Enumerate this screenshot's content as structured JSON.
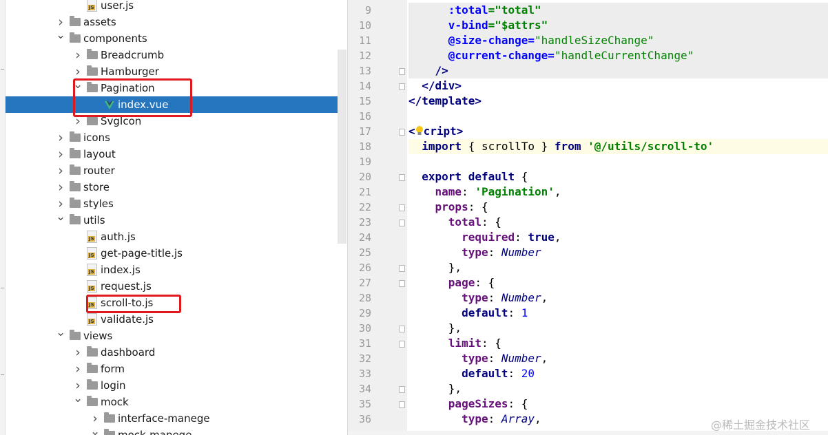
{
  "project_tree": {
    "rows": [
      {
        "label": "user.js",
        "icon": "js-file-icon",
        "chevron": ""
      },
      {
        "label": "assets",
        "icon": "folder-icon",
        "chevron": "right"
      },
      {
        "label": "components",
        "icon": "folder-icon",
        "chevron": "down"
      },
      {
        "label": "Breadcrumb",
        "icon": "folder-icon",
        "chevron": "right"
      },
      {
        "label": "Hamburger",
        "icon": "folder-icon",
        "chevron": "right"
      },
      {
        "label": "Pagination",
        "icon": "folder-icon",
        "chevron": "down"
      },
      {
        "label": "index.vue",
        "icon": "vue-file-icon",
        "chevron": "",
        "selected": true
      },
      {
        "label": "SvgIcon",
        "icon": "folder-icon",
        "chevron": "right"
      },
      {
        "label": "icons",
        "icon": "folder-icon",
        "chevron": "right"
      },
      {
        "label": "layout",
        "icon": "folder-icon",
        "chevron": "right"
      },
      {
        "label": "router",
        "icon": "folder-icon",
        "chevron": "right"
      },
      {
        "label": "store",
        "icon": "folder-icon",
        "chevron": "right"
      },
      {
        "label": "styles",
        "icon": "folder-icon",
        "chevron": "right"
      },
      {
        "label": "utils",
        "icon": "folder-icon",
        "chevron": "down"
      },
      {
        "label": "auth.js",
        "icon": "js-file-icon",
        "chevron": ""
      },
      {
        "label": "get-page-title.js",
        "icon": "js-file-icon",
        "chevron": ""
      },
      {
        "label": "index.js",
        "icon": "js-file-icon",
        "chevron": ""
      },
      {
        "label": "request.js",
        "icon": "js-file-icon",
        "chevron": ""
      },
      {
        "label": "scroll-to.js",
        "icon": "js-file-icon",
        "chevron": ""
      },
      {
        "label": "validate.js",
        "icon": "js-file-icon",
        "chevron": ""
      },
      {
        "label": "views",
        "icon": "folder-icon",
        "chevron": "down"
      },
      {
        "label": "dashboard",
        "icon": "folder-icon",
        "chevron": "right"
      },
      {
        "label": "form",
        "icon": "folder-icon",
        "chevron": "right"
      },
      {
        "label": "login",
        "icon": "folder-icon",
        "chevron": "right"
      },
      {
        "label": "mock",
        "icon": "folder-icon",
        "chevron": "down"
      },
      {
        "label": "interface-manege",
        "icon": "folder-icon",
        "chevron": "right"
      },
      {
        "label": "mock-manege",
        "icon": "folder-icon",
        "chevron": "down"
      }
    ],
    "js_badge": "JS",
    "colors": {
      "selection": "#2675bf",
      "highlight_box": "#e0191e"
    }
  },
  "editor": {
    "current_line": "18",
    "lines": [
      {
        "num": "9",
        "text": "      :total=\"total\""
      },
      {
        "num": "10",
        "text": "      v-bind=\"$attrs\""
      },
      {
        "num": "11",
        "text": "      @size-change=\"handleSizeChange\""
      },
      {
        "num": "12",
        "text": "      @current-change=\"handleCurrentChange\""
      },
      {
        "num": "13",
        "text": "    />"
      },
      {
        "num": "14",
        "text": "  </div>"
      },
      {
        "num": "15",
        "text": "</template>"
      },
      {
        "num": "16",
        "text": ""
      },
      {
        "num": "17",
        "text": "<script>"
      },
      {
        "num": "18",
        "text": "  import { scrollTo } from '@/utils/scroll-to'"
      },
      {
        "num": "19",
        "text": ""
      },
      {
        "num": "20",
        "text": "  export default {"
      },
      {
        "num": "21",
        "text": "    name: 'Pagination',"
      },
      {
        "num": "22",
        "text": "    props: {"
      },
      {
        "num": "23",
        "text": "      total: {"
      },
      {
        "num": "24",
        "text": "        required: true,"
      },
      {
        "num": "25",
        "text": "        type: Number"
      },
      {
        "num": "26",
        "text": "      },"
      },
      {
        "num": "27",
        "text": "      page: {"
      },
      {
        "num": "28",
        "text": "        type: Number,"
      },
      {
        "num": "29",
        "text": "        default: 1"
      },
      {
        "num": "30",
        "text": "      },"
      },
      {
        "num": "31",
        "text": "      limit: {"
      },
      {
        "num": "32",
        "text": "        type: Number,"
      },
      {
        "num": "33",
        "text": "        default: 20"
      },
      {
        "num": "34",
        "text": "      },"
      },
      {
        "num": "35",
        "text": "      pageSizes: {"
      },
      {
        "num": "36",
        "text": "        type: Array,"
      }
    ]
  },
  "watermark": "@稀土掘金技术社区"
}
